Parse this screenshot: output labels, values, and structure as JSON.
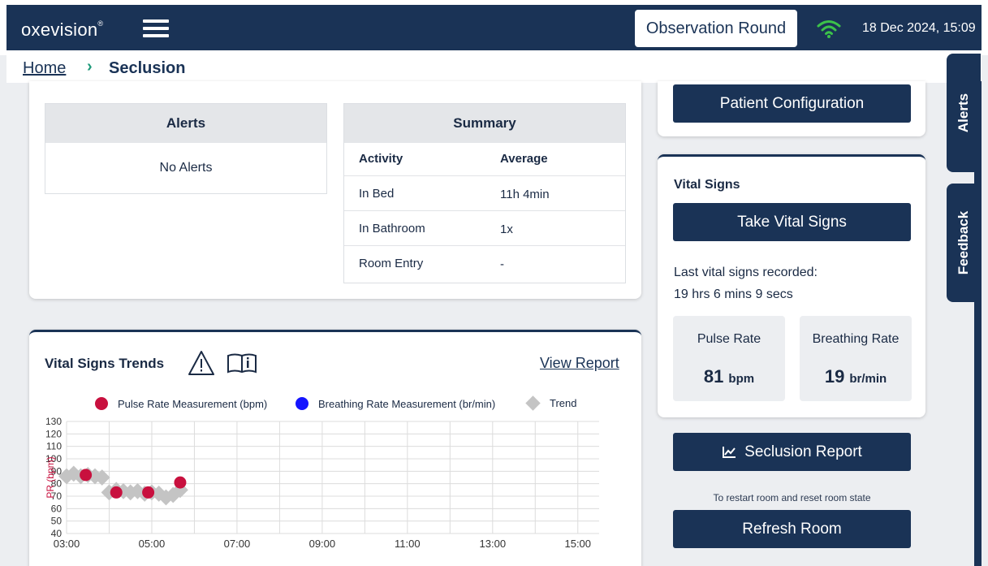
{
  "app": {
    "brand": "oxevision",
    "brand_mark": "®",
    "observation_button": "Observation Round",
    "datetime": "18 Dec 2024, 15:09",
    "colors": {
      "navy": "#1a3356",
      "teal": "#1e9a7a",
      "wifi": "#3cc24a",
      "pulse": "#c8103e",
      "breathing": "#1414ff",
      "trend": "#c4c4c4"
    }
  },
  "breadcrumb": {
    "home": "Home",
    "separator": "›",
    "current": "Seclusion"
  },
  "side_tabs": {
    "alerts": "Alerts",
    "feedback": "Feedback"
  },
  "alerts": {
    "header": "Alerts",
    "empty": "No Alerts"
  },
  "summary": {
    "header": "Summary",
    "columns": [
      "Activity",
      "Average"
    ],
    "rows": [
      {
        "activity": "In Bed",
        "average": "11h 4min"
      },
      {
        "activity": "In Bathroom",
        "average": "1x"
      },
      {
        "activity": "Room Entry",
        "average": "-"
      }
    ]
  },
  "patient_config_button": "Patient Configuration",
  "vital_signs": {
    "title": "Vital Signs",
    "take_button": "Take Vital Signs",
    "last_recorded_label": "Last vital signs recorded:",
    "last_recorded_value": "19 hrs 6 mins 9 secs",
    "pulse": {
      "label": "Pulse Rate",
      "value": "81",
      "unit": "bpm"
    },
    "breathing": {
      "label": "Breathing Rate",
      "value": "19",
      "unit": "br/min"
    }
  },
  "seclusion_report_button": "Seclusion Report",
  "restart_note": "To restart room and reset room state",
  "refresh_room_button": "Refresh Room",
  "trends": {
    "title": "Vital Signs Trends",
    "view_report": "View Report",
    "icons": [
      "warning-triangle-icon",
      "book-info-icon"
    ]
  },
  "chart_data": {
    "type": "scatter",
    "title": "",
    "xlabel": "",
    "ylabel": "PR (bpm)",
    "x_ticks": [
      "03:00",
      "05:00",
      "07:00",
      "09:00",
      "11:00",
      "13:00",
      "15:00"
    ],
    "y_ticks": [
      40,
      50,
      60,
      70,
      80,
      90,
      100,
      110,
      120,
      130
    ],
    "xlim": [
      "03:00",
      "15:30"
    ],
    "ylim": [
      40,
      130
    ],
    "grid": true,
    "legend": [
      "Pulse Rate Measurement (bpm)",
      "Breathing Rate Measurement (br/min)",
      "Trend"
    ],
    "series": [
      {
        "name": "Pulse Rate Measurement (bpm)",
        "marker": "circle",
        "points": [
          {
            "x": "03:27",
            "y": 87
          },
          {
            "x": "04:10",
            "y": 73
          },
          {
            "x": "04:55",
            "y": 73
          },
          {
            "x": "05:40",
            "y": 81
          }
        ]
      },
      {
        "name": "Breathing Rate Measurement (br/min)",
        "marker": "circle",
        "points": []
      },
      {
        "name": "Trend",
        "marker": "diamond",
        "points": [
          {
            "x": "03:00",
            "y": 86
          },
          {
            "x": "03:10",
            "y": 88
          },
          {
            "x": "03:20",
            "y": 86
          },
          {
            "x": "03:30",
            "y": 87
          },
          {
            "x": "03:40",
            "y": 86
          },
          {
            "x": "03:50",
            "y": 85
          },
          {
            "x": "04:00",
            "y": 73
          },
          {
            "x": "04:10",
            "y": 75
          },
          {
            "x": "04:20",
            "y": 74
          },
          {
            "x": "04:30",
            "y": 73
          },
          {
            "x": "04:40",
            "y": 74
          },
          {
            "x": "04:50",
            "y": 72
          },
          {
            "x": "05:00",
            "y": 73
          },
          {
            "x": "05:10",
            "y": 72
          },
          {
            "x": "05:20",
            "y": 69
          },
          {
            "x": "05:30",
            "y": 71
          },
          {
            "x": "05:40",
            "y": 75
          }
        ]
      }
    ]
  }
}
